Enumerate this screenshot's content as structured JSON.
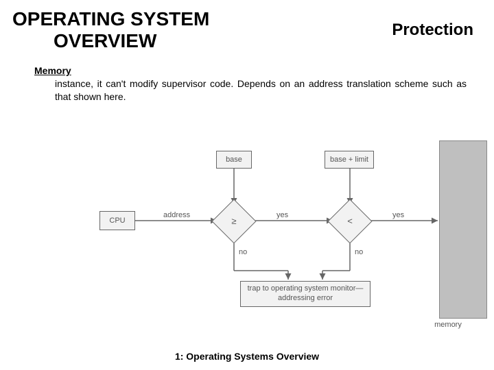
{
  "header": {
    "title_line1": "OPERATING SYSTEM",
    "title_line2": "OVERVIEW",
    "subtitle": "Protection"
  },
  "body": {
    "memory_label": "Memory",
    "paragraph": "instance, it can't modify supervisor code.    Depends on an address translation scheme such as that shown here."
  },
  "diagram": {
    "cpu": "CPU",
    "base": "base",
    "base_plus_limit": "base + limit",
    "ge_symbol": "≥",
    "lt_symbol": "<",
    "address_label": "address",
    "yes_label": "yes",
    "no_label": "no",
    "trap_text": "trap to operating system monitor—addressing error",
    "memory_caption": "memory"
  },
  "footer": {
    "caption": "1: Operating Systems Overview"
  }
}
